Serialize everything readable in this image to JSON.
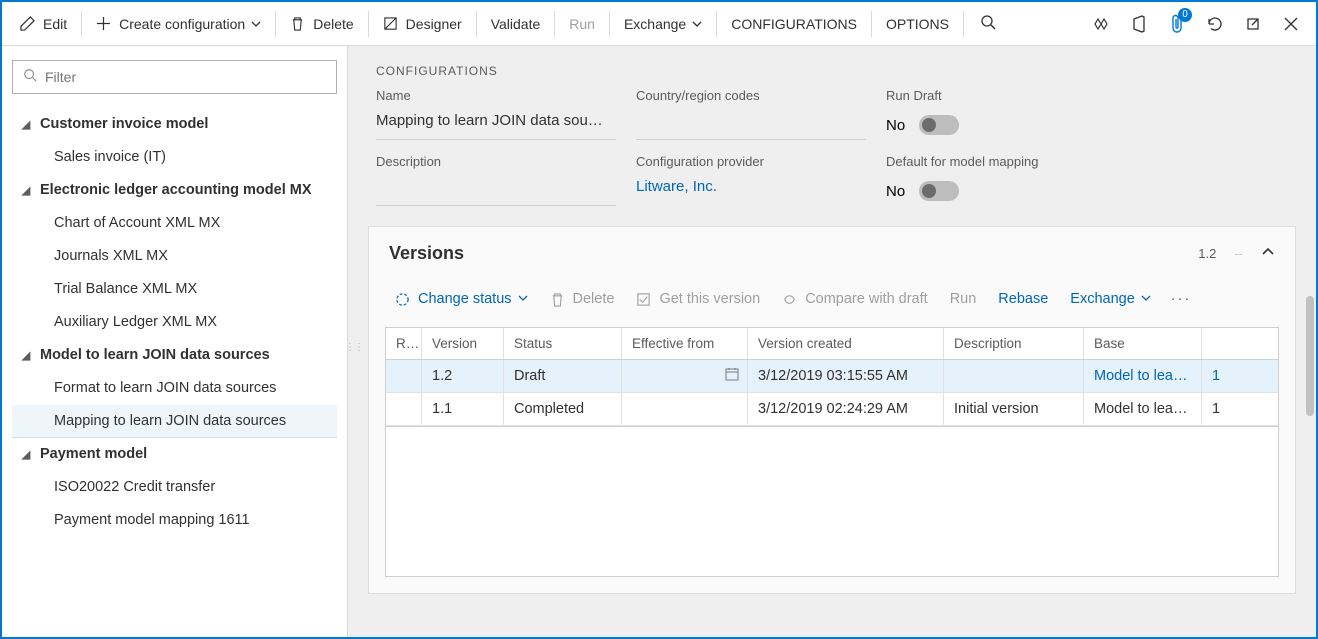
{
  "toolbar": {
    "edit": "Edit",
    "create": "Create configuration",
    "del": "Delete",
    "designer": "Designer",
    "validate": "Validate",
    "run": "Run",
    "exchange": "Exchange",
    "configurations": "CONFIGURATIONS",
    "options": "OPTIONS"
  },
  "badge": "0",
  "filter": {
    "placeholder": "Filter"
  },
  "tree": {
    "n0": "Customer invoice model",
    "n0_0": "Sales invoice (IT)",
    "n1": "Electronic ledger accounting model MX",
    "n1_0": "Chart of Account XML MX",
    "n1_1": "Journals XML MX",
    "n1_2": "Trial Balance XML MX",
    "n1_3": "Auxiliary Ledger XML MX",
    "n2": "Model to learn JOIN data sources",
    "n2_0": "Format to learn JOIN data sources",
    "n2_1": "Mapping to learn JOIN data sources",
    "n3": "Payment model",
    "n3_0": "ISO20022 Credit transfer",
    "n3_1": "Payment model mapping 1611"
  },
  "config": {
    "section": "CONFIGURATIONS",
    "name_label": "Name",
    "name_value": "Mapping to learn JOIN data sou…",
    "desc_label": "Description",
    "country_label": "Country/region codes",
    "provider_label": "Configuration provider",
    "provider_value": "Litware, Inc.",
    "rundraft_label": "Run Draft",
    "rundraft_value": "No",
    "default_label": "Default for model mapping",
    "default_value": "No"
  },
  "versions": {
    "title": "Versions",
    "current": "1.2",
    "sep": "--",
    "change_status": "Change status",
    "del": "Delete",
    "get": "Get this version",
    "compare": "Compare with draft",
    "run": "Run",
    "rebase": "Rebase",
    "exchange": "Exchange",
    "cols": {
      "r": "R...",
      "ver": "Version",
      "status": "Status",
      "eff": "Effective from",
      "created": "Version created",
      "desc": "Description",
      "base": "Base"
    },
    "row1": {
      "ver": "1.2",
      "status": "Draft",
      "created": "3/12/2019 03:15:55 AM",
      "desc": "",
      "base": "Model to lear…",
      "b2": "1"
    },
    "row2": {
      "ver": "1.1",
      "status": "Completed",
      "created": "3/12/2019 02:24:29 AM",
      "desc": "Initial version",
      "base": "Model to lear…",
      "b2": "1"
    }
  }
}
